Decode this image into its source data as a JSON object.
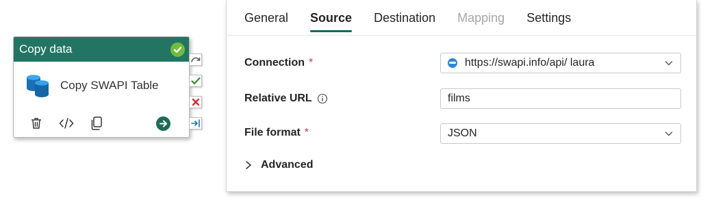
{
  "activity": {
    "type_label": "Copy data",
    "name": "Copy SWAPI Table",
    "status_icon": "check-circle-icon",
    "toolbar": [
      "delete-icon",
      "code-icon",
      "copy-icon",
      "run-arrow-icon"
    ],
    "ports": [
      "skip-icon",
      "success-icon",
      "failure-icon",
      "completion-icon"
    ],
    "header_color": "#237563"
  },
  "panel": {
    "tabs": [
      {
        "label": "General",
        "state": "normal"
      },
      {
        "label": "Source",
        "state": "active"
      },
      {
        "label": "Destination",
        "state": "normal"
      },
      {
        "label": "Mapping",
        "state": "disabled"
      },
      {
        "label": "Settings",
        "state": "normal"
      }
    ],
    "fields": {
      "connection": {
        "label": "Connection",
        "required_mark": "*",
        "value": "https://swapi.info/api/ laura"
      },
      "relative_url": {
        "label": "Relative URL",
        "value": "films"
      },
      "file_format": {
        "label": "File format",
        "required_mark": "*",
        "value": "JSON"
      }
    },
    "advanced_label": "Advanced",
    "accent_color": "#0f6b5b",
    "required_color": "#c4314b"
  }
}
